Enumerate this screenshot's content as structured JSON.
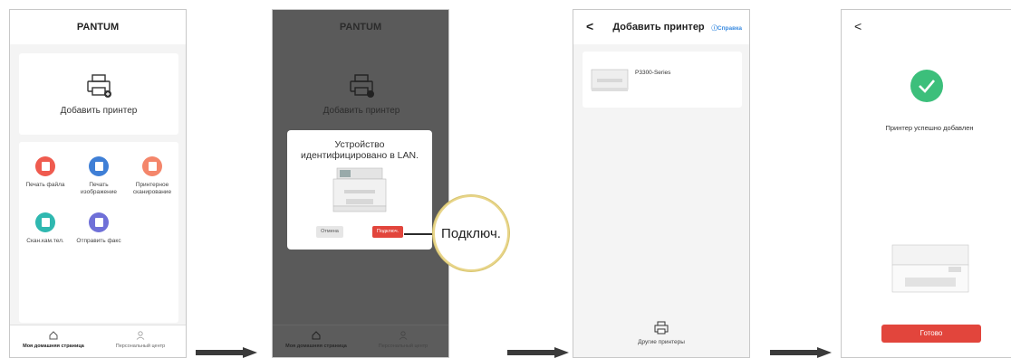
{
  "screen1": {
    "title": "PANTUM",
    "add_printer": "Добавить принтер",
    "functions": [
      {
        "label": "Печать файла",
        "color": "#ef5b4f"
      },
      {
        "label": "Печать изображение",
        "color": "#3f7fd6"
      },
      {
        "label": "Принтерное сканирование",
        "color": "#f4866b"
      },
      {
        "label": "Скан.кам.тел.",
        "color": "#2fb8b0"
      },
      {
        "label": "Отправить факс",
        "color": "#6f70d8"
      }
    ],
    "tabs": [
      "Моя домашняя страница",
      "Персональный центр"
    ]
  },
  "screen2": {
    "title": "PANTUM",
    "add_printer": "Добавить принтер",
    "dialog_message": "Устройство идентифицировано в LAN.",
    "cancel": "Отмена",
    "connect": "Подключ.",
    "zoom_label": "Подключ.",
    "tabs": [
      "Моя домашняя страница",
      "Персональный центр"
    ]
  },
  "screen3": {
    "back": "<",
    "title": "Добавить принтер",
    "help": "Справка",
    "device_name": "P3300-Series",
    "other_printers": "Другие принтеры"
  },
  "screen4": {
    "back": "<",
    "success": "Принтер успешно добавлен",
    "done": "Готово"
  },
  "colors": {
    "accent": "#e2453c",
    "success": "#3cbf7b",
    "link": "#3a8be0"
  }
}
